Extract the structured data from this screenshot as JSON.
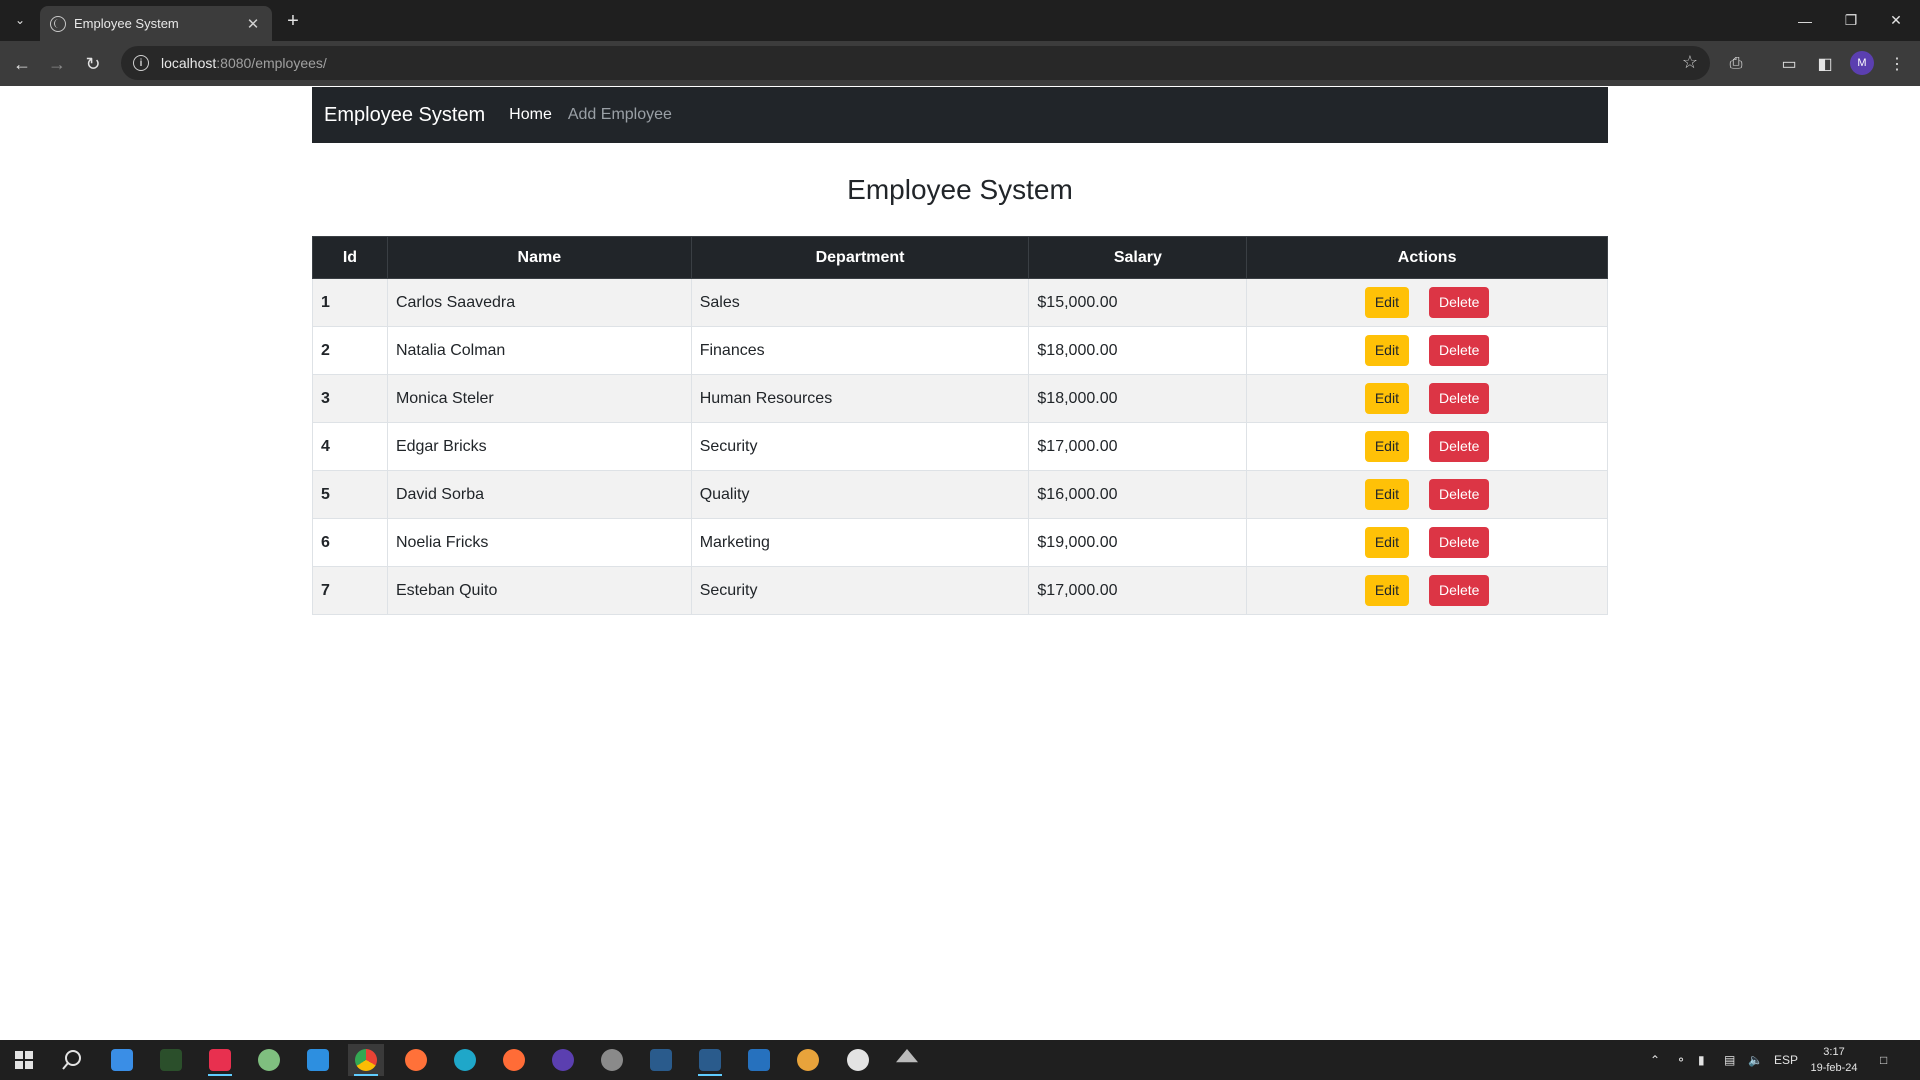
{
  "browser": {
    "tab_title": "Employee System",
    "url_host": "localhost",
    "url_path": ":8080/employees/",
    "profile_initial": "M",
    "icons": [
      "tab-list-icon",
      "globe-icon",
      "close-icon",
      "plus-icon",
      "minimize-icon",
      "restore-icon",
      "back-icon",
      "forward-icon",
      "reload-icon",
      "info-icon",
      "star-icon",
      "extensions-icon",
      "cast-icon",
      "sidepanel-icon",
      "menu-icon"
    ]
  },
  "navbar": {
    "brand": "Employee System",
    "links": [
      {
        "label": "Home",
        "active": true
      },
      {
        "label": "Add Employee",
        "active": false
      }
    ]
  },
  "main": {
    "heading": "Employee System",
    "table": {
      "headers": [
        "Id",
        "Name",
        "Department",
        "Salary",
        "Actions"
      ],
      "rows": [
        {
          "id": "1",
          "name": "Carlos Saavedra",
          "department": "Sales",
          "salary": "$15,000.00"
        },
        {
          "id": "2",
          "name": "Natalia Colman",
          "department": "Finances",
          "salary": "$18,000.00"
        },
        {
          "id": "3",
          "name": "Monica Steler",
          "department": "Human Resources",
          "salary": "$18,000.00"
        },
        {
          "id": "4",
          "name": "Edgar Bricks",
          "department": "Security",
          "salary": "$17,000.00"
        },
        {
          "id": "5",
          "name": "David Sorba",
          "department": "Quality",
          "salary": "$16,000.00"
        },
        {
          "id": "6",
          "name": "Noelia Fricks",
          "department": "Marketing",
          "salary": "$19,000.00"
        },
        {
          "id": "7",
          "name": "Esteban Quito",
          "department": "Security",
          "salary": "$17,000.00"
        }
      ],
      "edit_label": "Edit",
      "delete_label": "Delete"
    }
  },
  "taskbar": {
    "language": "ESP",
    "time": "3:17",
    "date": "19-feb-24"
  },
  "colors": {
    "navbar_bg": "#212529",
    "edit_button": "#ffc107",
    "delete_button": "#dc3545"
  }
}
